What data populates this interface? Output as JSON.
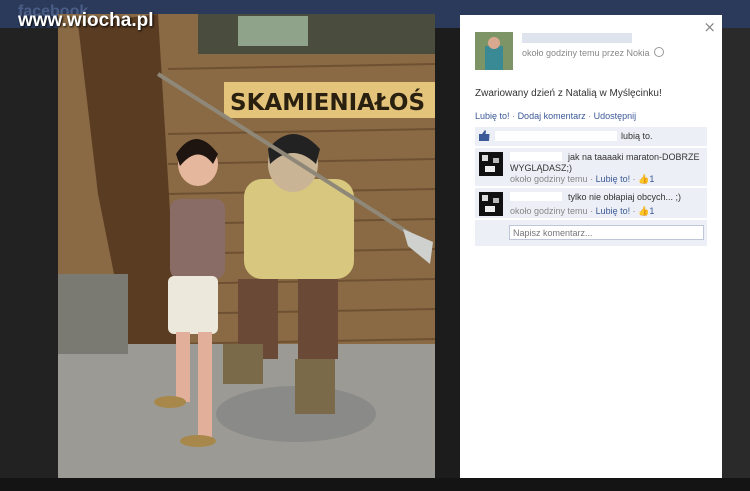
{
  "watermark": "www.wiocha.pl",
  "background": {
    "logo": "facebook"
  },
  "photo": {
    "sign_text": "SKAMIENIAŁOŚ"
  },
  "panel": {
    "close_label": "×",
    "author": "",
    "meta": "około godziny temu przez Nokia",
    "caption": "Zwariowany dzień z Natalią w Myślęcinku!",
    "actions": {
      "like": "Lubię to!",
      "comment": "Dodaj komentarz",
      "share": "Udostępnij",
      "sep": "·"
    },
    "likes_text": "lubią to.",
    "comments": [
      {
        "text": "jak na taaaaki maraton-DOBRZE WYGLĄDASZ;)",
        "time": "około godziny temu",
        "like": "Lubię to!",
        "count": "1"
      },
      {
        "text": "tylko nie obłapiaj obcych... ;)",
        "time": "około godziny temu",
        "like": "Lubię to!",
        "count": "1"
      }
    ],
    "comment_placeholder": "Napisz komentarz..."
  },
  "colors": {
    "link": "#3b5998",
    "panel_bg": "#eceff5"
  }
}
